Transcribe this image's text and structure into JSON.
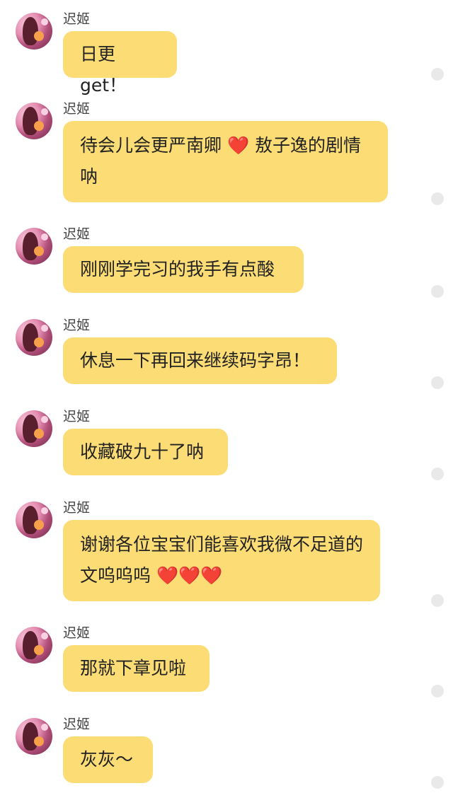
{
  "sender": "迟姬",
  "messages": [
    {
      "text": "日更 get！"
    },
    {
      "text": "待会儿会更严南卿 ❤️ 敖子逸的剧情呐"
    },
    {
      "text": "刚刚学完习的我手有点酸"
    },
    {
      "text": "休息一下再回来继续码字昂！"
    },
    {
      "text": "收藏破九十了呐"
    },
    {
      "text": "谢谢各位宝宝们能喜欢我微不足道的文呜呜呜 ❤️❤️❤️"
    },
    {
      "text": "那就下章见啦"
    },
    {
      "text": "灰灰～"
    }
  ],
  "colors": {
    "bubble": "#fcdc74",
    "status_dot": "#e9e9e9",
    "name_text": "#444444"
  },
  "icons": {
    "avatar": "user-avatar",
    "status": "read-status-dot-icon"
  }
}
